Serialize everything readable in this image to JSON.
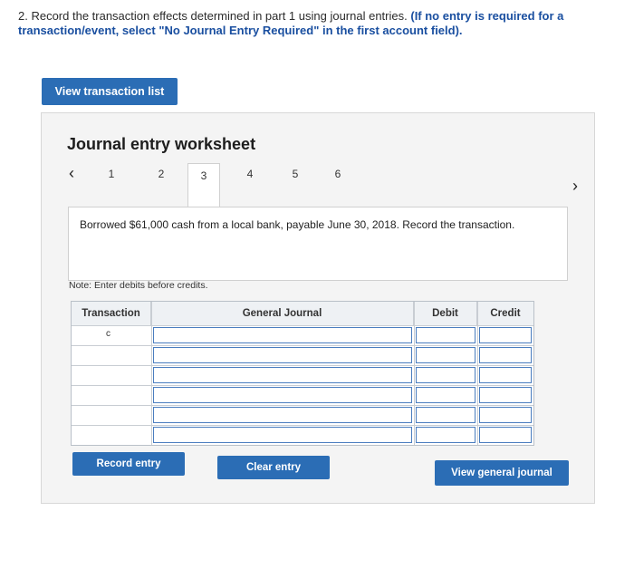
{
  "instructions": {
    "prefix": "2. Record the transaction effects determined in part 1 using journal entries.",
    "bold": "(If no entry is required for a transaction/event, select \"No Journal Entry Required\" in the first account field)."
  },
  "buttons": {
    "view_list": "View transaction list",
    "record": "Record entry",
    "clear": "Clear entry",
    "view_general": "View general journal"
  },
  "worksheet": {
    "title": "Journal entry worksheet",
    "prev_icon": "‹",
    "next_icon": "›",
    "tabs": [
      "1",
      "2",
      "3",
      "4",
      "5",
      "6"
    ],
    "active_tab": "3",
    "description": "Borrowed $61,000 cash from a local bank, payable June 30, 2018. Record the transaction.",
    "note": "Note: Enter debits before credits."
  },
  "journal_table": {
    "headers": {
      "transaction": "Transaction",
      "general_journal": "General Journal",
      "debit": "Debit",
      "credit": "Credit"
    },
    "first_row_label": "c"
  }
}
